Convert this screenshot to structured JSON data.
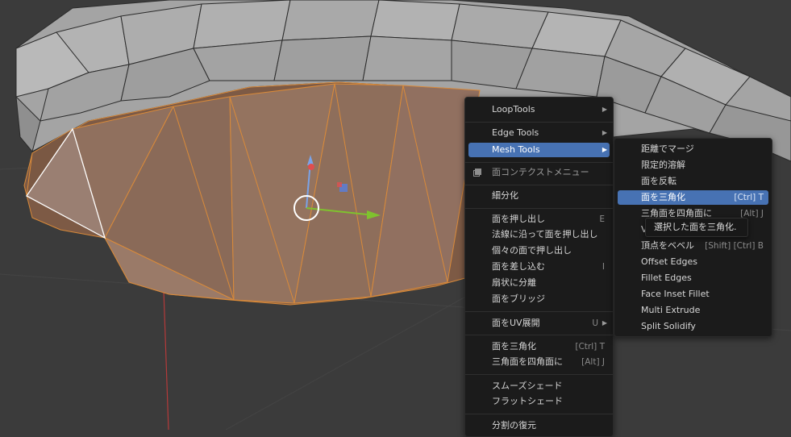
{
  "context_menu": {
    "items": [
      {
        "label": "LoopTools",
        "has_submenu": true
      },
      {
        "label": "Edge Tools",
        "has_submenu": true
      },
      {
        "label": "Mesh Tools",
        "has_submenu": true,
        "highlighted": true
      },
      {
        "label": "面コンテクストメニュー",
        "header": true
      },
      {
        "label": "細分化"
      },
      {
        "label": "面を押し出し",
        "shortcut": "E"
      },
      {
        "label": "法線に沿って面を押し出し"
      },
      {
        "label": "個々の面で押し出し"
      },
      {
        "label": "面を差し込む",
        "shortcut": "I"
      },
      {
        "label": "扇状に分離"
      },
      {
        "label": "面をブリッジ"
      },
      {
        "label": "面をUV展開",
        "shortcut": "U",
        "has_submenu": true
      },
      {
        "label": "面を三角化",
        "shortcut": "[Ctrl] T"
      },
      {
        "label": "三角面を四角面に",
        "shortcut": "[Alt] J"
      },
      {
        "label": "スムーズシェード"
      },
      {
        "label": "フラットシェード"
      },
      {
        "label": "分割の復元"
      }
    ]
  },
  "submenu": {
    "items": [
      {
        "label": "距離でマージ"
      },
      {
        "label": "限定的溶解"
      },
      {
        "label": "面を反転"
      },
      {
        "label": "面を三角化",
        "shortcut": "[Ctrl] T",
        "highlighted": true
      },
      {
        "label": "三角面を四角面に",
        "shortcut": "[Alt] J"
      },
      {
        "label": "V"
      },
      {
        "label": "頂点をベベル",
        "shortcut": "[Shift] [Ctrl] B"
      },
      {
        "label": "Offset Edges"
      },
      {
        "label": "Fillet Edges"
      },
      {
        "label": "Face Inset Fillet"
      },
      {
        "label": "Multi Extrude"
      },
      {
        "label": "Split Solidify"
      }
    ]
  },
  "tooltip": {
    "text": "選択した面を三角化."
  },
  "colors": {
    "background": "#3a3a3a",
    "mesh_face": "#a9a9a9",
    "selected_face": "#8c6a56",
    "selection_edge": "#e08a2c",
    "menu_bg": "#1b1b1b",
    "highlight": "#4772b3"
  }
}
